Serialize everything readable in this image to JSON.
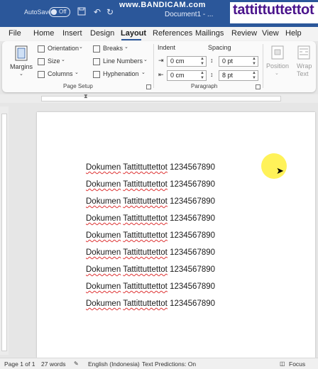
{
  "titlebar": {
    "autosave_label": "AutoSave",
    "autosave_state": "Off",
    "watermark": "www.BANDICAM.com",
    "doc_title": "Document1 - ...",
    "banner_text": "tattittuttettot"
  },
  "menu": {
    "tabs": [
      "File",
      "Home",
      "Insert",
      "Design",
      "Layout",
      "References",
      "Mailings",
      "Review",
      "View",
      "Help"
    ],
    "active": "Layout"
  },
  "ribbon": {
    "page_setup": {
      "margins": "Margins",
      "orientation": "Orientation",
      "size": "Size",
      "columns": "Columns",
      "breaks": "Breaks",
      "line_numbers": "Line Numbers",
      "hyphenation": "Hyphenation",
      "group_label": "Page Setup"
    },
    "paragraph": {
      "indent_label": "Indent",
      "spacing_label": "Spacing",
      "indent_left": "0 cm",
      "indent_right": "0 cm",
      "spacing_before": "0 pt",
      "spacing_after": "8 pt",
      "group_label": "Paragraph"
    },
    "arrange": {
      "position": "Position",
      "wrap_text_1": "Wrap",
      "wrap_text_2": "Text"
    }
  },
  "document": {
    "lines": [
      {
        "word1": "Dokumen",
        "word2": "Tattittuttettot",
        "number": "1234567890"
      },
      {
        "word1": "Dokumen",
        "word2": "Tattittuttettot",
        "number": "1234567890"
      },
      {
        "word1": "Dokumen",
        "word2": "Tattittuttettot",
        "number": "1234567890"
      },
      {
        "word1": "Dokumen",
        "word2": "Tattittuttettot",
        "number": "1234567890"
      },
      {
        "word1": "Dokumen",
        "word2": "Tattittuttettot",
        "number": "1234567890"
      },
      {
        "word1": "Dokumen",
        "word2": "Tattittuttettot",
        "number": "1234567890"
      },
      {
        "word1": "Dokumen",
        "word2": "Tattittuttettot",
        "number": "1234567890"
      },
      {
        "word1": "Dokumen",
        "word2": "Tattittuttettot",
        "number": "1234567890"
      },
      {
        "word1": "Dokumen",
        "word2": "Tattittuttettot",
        "number": "1234567890"
      }
    ]
  },
  "status": {
    "page": "Page 1 of 1",
    "words": "27 words",
    "language": "English (Indonesia)",
    "predictions": "Text Predictions: On",
    "focus": "Focus"
  },
  "colors": {
    "titlebar": "#2b579a",
    "banner_text": "#4a148c",
    "spell_underline": "#dd3333"
  }
}
